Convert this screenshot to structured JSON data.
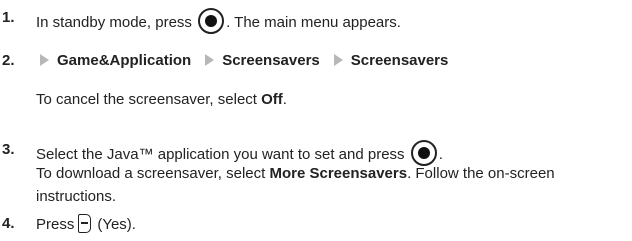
{
  "steps": [
    {
      "number": "1.",
      "text_before": "In standby mode, press",
      "text_after": ". The main menu appears."
    },
    {
      "number": "2.",
      "path": [
        "Game&Application",
        "Screensavers",
        "Screensavers"
      ]
    },
    {
      "number": "3.",
      "text_before": "Select the Java™ application you want to set and press",
      "text_after": "."
    },
    {
      "number": "4.",
      "text_before": "Press",
      "text_after": "(Yes)."
    }
  ],
  "step2_note": {
    "text": "To cancel the screensaver, select ",
    "bold": "Off",
    "end": "."
  },
  "step3_note": {
    "text": "To download a screensaver, select ",
    "bold": "More Screensavers",
    "end": ". Follow the on-screen"
  },
  "step3_note_line2": "instructions.",
  "icons": {
    "center_key": "center-select-key-icon",
    "soft_key": "left-soft-key-icon",
    "arrow": "path-arrow-icon"
  }
}
